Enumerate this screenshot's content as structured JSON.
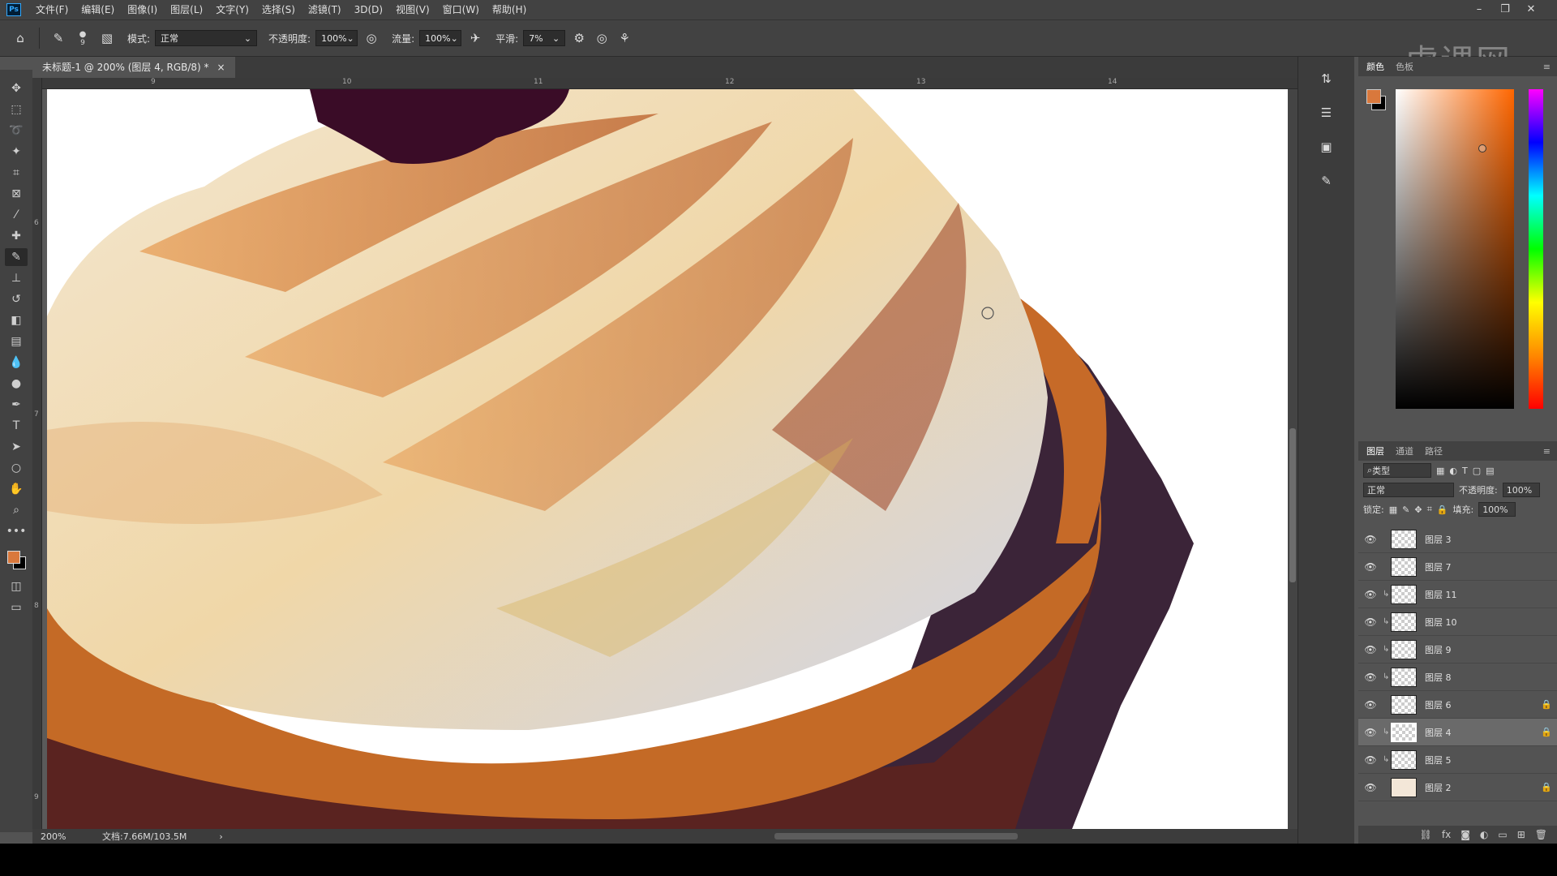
{
  "menubar": {
    "logo": "Ps",
    "items": [
      "文件(F)",
      "编辑(E)",
      "图像(I)",
      "图层(L)",
      "文字(Y)",
      "选择(S)",
      "滤镜(T)",
      "3D(D)",
      "视图(V)",
      "窗口(W)",
      "帮助(H)"
    ]
  },
  "options": {
    "brush_size": "9",
    "mode_label": "模式:",
    "mode_value": "正常",
    "opacity_label": "不透明度:",
    "opacity_value": "100%",
    "flow_label": "流量:",
    "flow_value": "100%",
    "smooth_label": "平滑:",
    "smooth_value": "7%"
  },
  "watermark": "虎课网",
  "document": {
    "tab_title": "未标题-1 @ 200% (图层 4, RGB/8) *",
    "tab_close": "×",
    "ruler_h": [
      "9",
      "10",
      "11",
      "12",
      "13",
      "14"
    ],
    "ruler_v": [
      "6",
      "7",
      "8",
      "9"
    ],
    "zoom": "200%",
    "doc_info": "文档:7.66M/103.5M"
  },
  "color_panel": {
    "tabs": [
      "颜色",
      "色板"
    ],
    "fg_color": "#d9783c",
    "bg_color": "#000000"
  },
  "layers_panel": {
    "tabs": [
      "图层",
      "通道",
      "路径"
    ],
    "filter_label": "类型",
    "blend_mode": "正常",
    "opacity_label": "不透明度:",
    "opacity_value": "100%",
    "lock_label": "锁定:",
    "fill_label": "填充:",
    "fill_value": "100%",
    "layers": [
      {
        "name": "图层 3",
        "clipped": false,
        "locked": false,
        "selected": false
      },
      {
        "name": "图层 7",
        "clipped": false,
        "locked": false,
        "selected": false
      },
      {
        "name": "图层 11",
        "clipped": true,
        "locked": false,
        "selected": false
      },
      {
        "name": "图层 10",
        "clipped": true,
        "locked": false,
        "selected": false
      },
      {
        "name": "图层 9",
        "clipped": true,
        "locked": false,
        "selected": false
      },
      {
        "name": "图层 8",
        "clipped": true,
        "locked": false,
        "selected": false
      },
      {
        "name": "图层 6",
        "clipped": false,
        "locked": true,
        "selected": false
      },
      {
        "name": "图层 4",
        "clipped": true,
        "locked": true,
        "selected": true
      },
      {
        "name": "图层 5",
        "clipped": true,
        "locked": false,
        "selected": false
      },
      {
        "name": "图层 2",
        "clipped": false,
        "locked": true,
        "selected": false
      }
    ]
  }
}
